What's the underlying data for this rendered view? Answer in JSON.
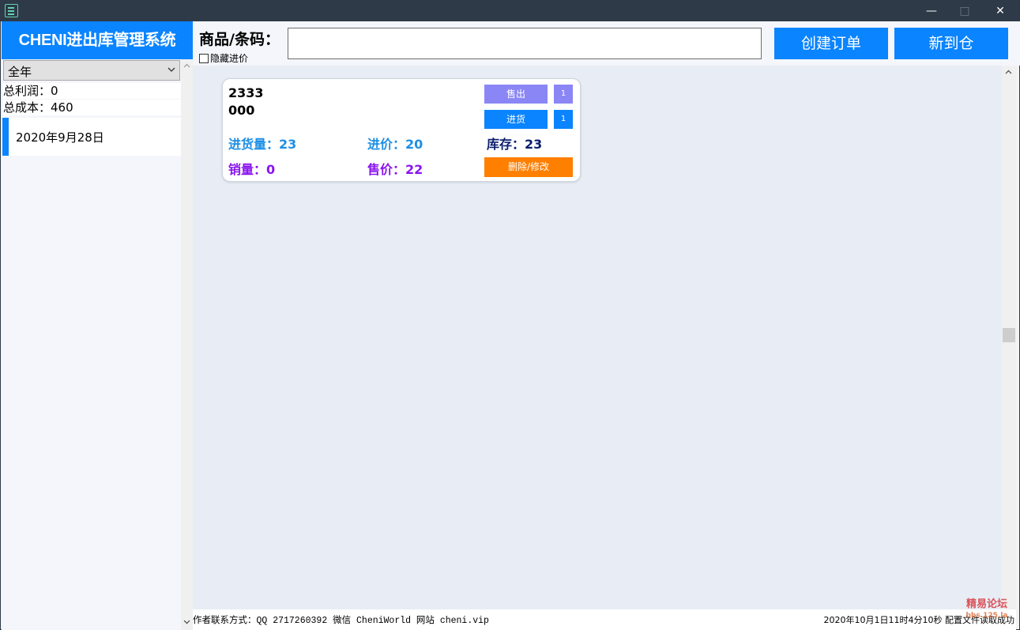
{
  "titlebar": {
    "minimize": "—",
    "maximize": "□",
    "close": "✕"
  },
  "sidebar": {
    "brand": "CHENI进出库管理系统",
    "period_select": "全年",
    "total_profit": "总利润：0",
    "total_cost": "总成本：460",
    "date_items": [
      {
        "label": "2020年9月28日"
      }
    ]
  },
  "toolbar": {
    "search_label": "商品/条码：",
    "search_value": "",
    "hide_cost_label": "隐藏进价",
    "hide_cost_checked": false,
    "create_order": "创建订单",
    "new_stock": "新到仓"
  },
  "products": [
    {
      "name_line1": "2333",
      "name_line2": "000",
      "in_qty": "进货量：23",
      "cost": "进价：20",
      "stock": "库存：23",
      "sold": "销量：0",
      "price": "售价：22",
      "sell_button": "售出",
      "sell_qty": "1",
      "restock_button": "进货",
      "restock_qty": "1",
      "edit_button": "删除/修改"
    }
  ],
  "footer": {
    "contact": "作者联系方式：QQ 2717260392 微信 CheniWorld 网站 cheni.vip",
    "status": "2020年10月1日11时4分10秒 配置文件读取成功"
  },
  "watermark": {
    "line1": "精易论坛",
    "line2": "bbs.125.la"
  },
  "colors": {
    "accent": "#0a84ff",
    "sell": "#8b86f5",
    "edit": "#ff7f00",
    "blue_text": "#1e8fe4",
    "purple_text": "#8a14ee",
    "navy_text": "#0b1e6e"
  }
}
